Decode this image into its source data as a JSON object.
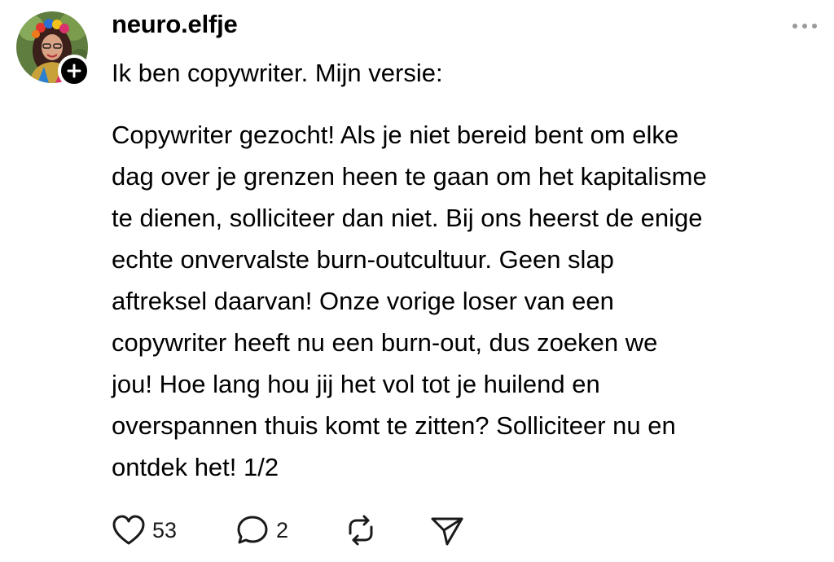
{
  "post": {
    "username": "neuro.elfje",
    "intro": "Ik ben copywriter. Mijn versie:",
    "body_lines": [
      "Copywriter gezocht! Als je niet bereid bent om elke",
      "dag over je grenzen heen te gaan om het kapitalisme",
      "te dienen, solliciteer dan niet. Bij ons heerst de enige",
      "echte onvervalste burn-outcultuur. Geen slap",
      "aftreksel daarvan! Onze vorige loser van een",
      "copywriter heeft nu een burn-out, dus zoeken we",
      "jou! Hoe lang hou jij het vol tot je huilend en",
      "overspannen thuis komt te zitten? Solliciteer nu en",
      "ontdek het! 1/2"
    ]
  },
  "actions": {
    "like_count": "53",
    "reply_count": "2"
  },
  "icons": {
    "like": "heart-icon",
    "reply": "speech-bubble-icon",
    "repost": "repost-icon",
    "share": "paper-plane-icon",
    "more": "ellipsis-icon",
    "follow": "plus-icon"
  },
  "colors": {
    "text": "#000000",
    "muted": "#9a9a9a",
    "background": "#ffffff"
  }
}
